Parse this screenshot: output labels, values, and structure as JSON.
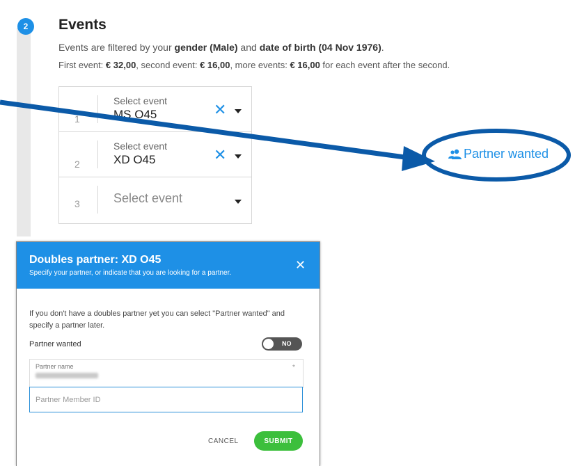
{
  "step": {
    "number": "2",
    "title": "Events"
  },
  "filter_text": {
    "prefix": "Events are filtered by your ",
    "gender": "gender (Male)",
    "middle": " and ",
    "dob": "date of birth (04 Nov 1976)",
    "suffix": "."
  },
  "pricing_text": {
    "first_label": "First event: ",
    "first_price": "€ 32,00",
    "second_label": ", second event: ",
    "second_price": "€ 16,00",
    "more_label": ", more events: ",
    "more_price": "€ 16,00",
    "more_suffix": " for each event after the second."
  },
  "events": [
    {
      "number": "1",
      "label": "Select event",
      "value": "MS O45"
    },
    {
      "number": "2",
      "label": "Select event",
      "value": "XD O45"
    },
    {
      "number": "3",
      "placeholder": "Select event"
    }
  ],
  "partner_wanted_link": "Partner wanted",
  "dialog": {
    "title": "Doubles partner: XD O45",
    "subtitle": "Specify your partner, or indicate that you are looking for a partner.",
    "info": "If you don't have a doubles partner yet you can select \"Partner wanted\" and specify a partner later.",
    "partner_wanted_label": "Partner wanted",
    "toggle_state": "NO",
    "partner_name_label": "Partner name",
    "partner_name_required": "*",
    "member_id_placeholder": "Partner Member ID",
    "cancel_label": "CANCEL",
    "submit_label": "SUBMIT"
  },
  "colors": {
    "accent": "#1e90e6",
    "annotation": "#0b5aa8",
    "submit": "#3cbf3c",
    "toggle_off": "#555555"
  },
  "icons": {
    "clear": "close-icon",
    "dropdown": "caret-down-icon",
    "partner": "users-icon"
  }
}
